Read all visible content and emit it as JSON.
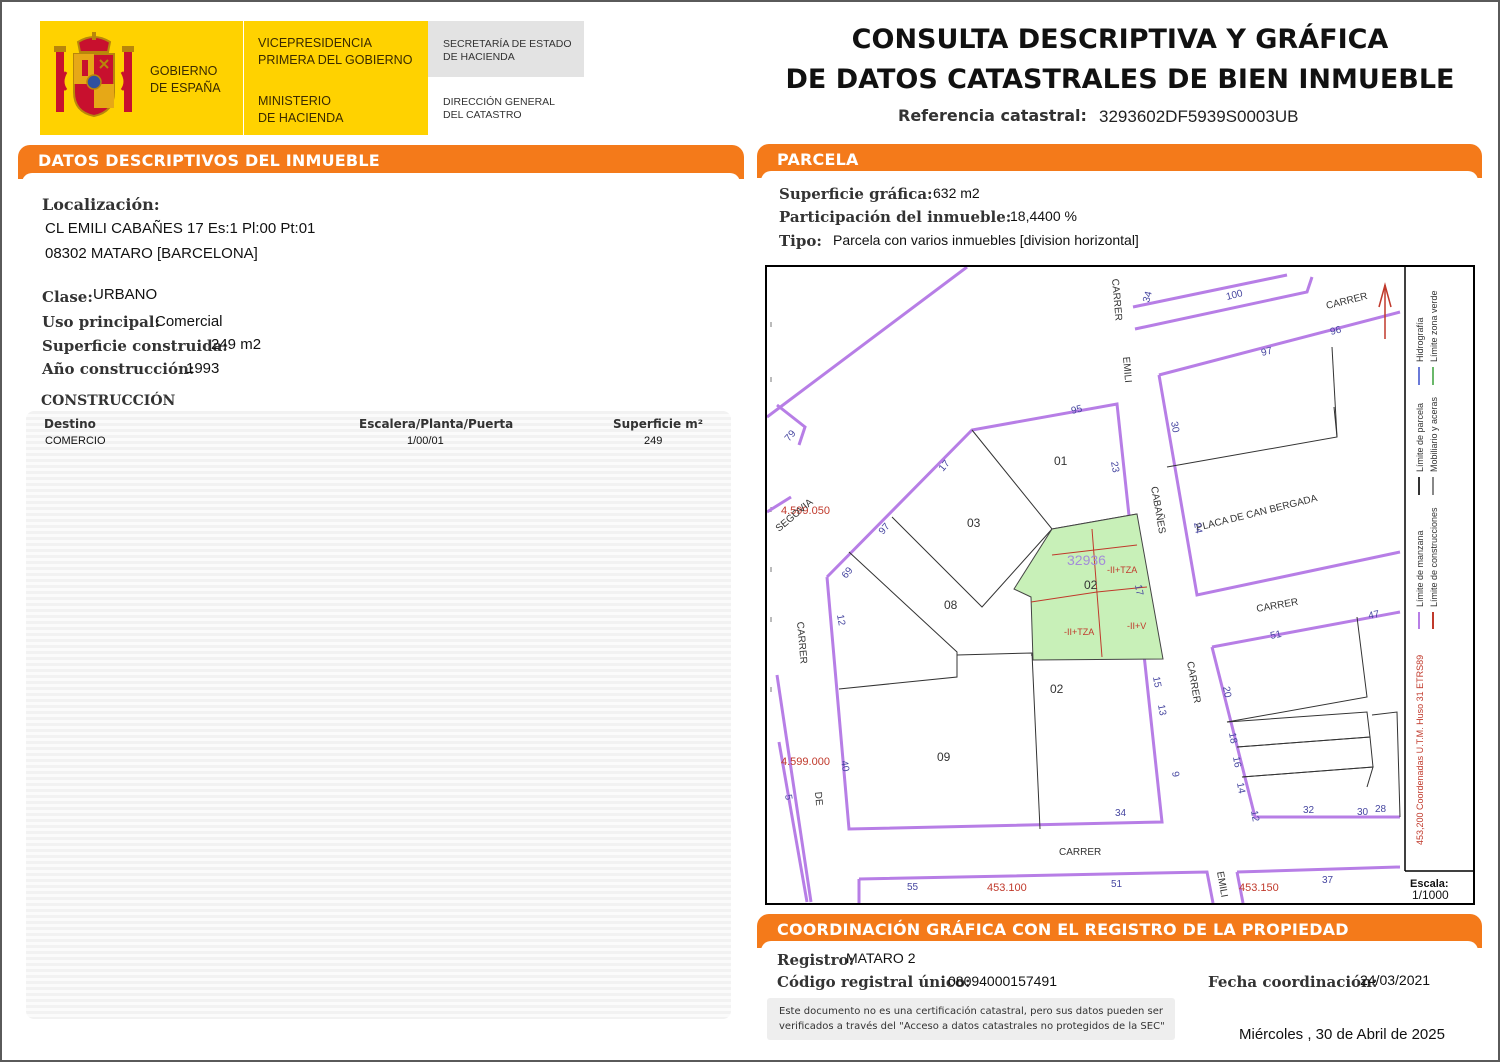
{
  "header": {
    "gov_line1": "Gobierno",
    "gov_line2": "de España",
    "vice_line1": "Vicepresidencia",
    "vice_line2": "Primera del Gobierno",
    "min_line1": "Ministerio",
    "min_line2": "de Hacienda",
    "sec_line1": "Secretaría de Estado",
    "sec_line2": "de Hacienda",
    "dir_line1": "Dirección General",
    "dir_line2": "del Catastro",
    "title_line1": "CONSULTA DESCRIPTIVA Y GRÁFICA",
    "title_line2": "DE DATOS CATASTRALES DE BIEN INMUEBLE",
    "ref_label": "Referencia catastral:",
    "ref_value": "3293602DF5939S0003UB"
  },
  "descriptivos": {
    "section_title": "DATOS DESCRIPTIVOS DEL INMUEBLE",
    "loc_label": "Localización:",
    "loc_line1": "CL EMILI CABAÑES 17 Es:1 Pl:00 Pt:01",
    "loc_line2": "08302 MATARO [BARCELONA]",
    "clase_label": "Clase:",
    "clase_value": "URBANO",
    "uso_label": "Uso principal:",
    "uso_value": "Comercial",
    "sup_label": "Superficie construida:",
    "sup_value": "249 m2",
    "anio_label": "Año construcción:",
    "anio_value": "1993"
  },
  "construccion": {
    "title": "CONSTRUCCIÓN",
    "col_destino": "Destino",
    "col_epp": "Escalera/Planta/Puerta",
    "col_sup": "Superficie m²",
    "rows": [
      {
        "destino": "COMERCIO",
        "epp": "1/00/01",
        "sup": "249"
      }
    ]
  },
  "parcela": {
    "section_title": "PARCELA",
    "sup_label": "Superficie gráfica:",
    "sup_value": "632 m2",
    "part_label": "Participación del inmueble:",
    "part_value": "18,4400 %",
    "tipo_label": "Tipo:",
    "tipo_value": "Parcela con varios inmuebles [division horizontal]"
  },
  "map": {
    "parcel_id": "32936",
    "parcel_tag1": "-II+TZA",
    "parcel_tag2": "-II+TZA",
    "parcel_tag3": "-II+V",
    "parcel_number": "02",
    "parcel_num_17": "17",
    "lot_01": "01",
    "lot_03": "03",
    "lot_08": "08",
    "lot_02b": "02",
    "lot_09": "09",
    "plaza": "PLACA DE CAN BERGADA",
    "street_carrer_top": "CARRER",
    "street_carrer_mid": "CARRER",
    "street_carrer_bottom": "CARRER",
    "street_carrer_left": "CARRER",
    "street_carrer_right": "CARRER",
    "street_emili": "EMILI",
    "street_cabanes": "CABAÑES",
    "street_segovia": "SEGOVIA",
    "street_de": "DE",
    "street_emili_bottom": "EMILI",
    "coord_y1": "4.599.050",
    "coord_y2": "4.599.000",
    "coord_x1": "453.100",
    "coord_x2": "453.150",
    "n_34": "34",
    "n_100": "100",
    "n_96": "96",
    "n_97": "97",
    "n_95": "95",
    "n_23": "23",
    "n_30": "30",
    "n_24": "24",
    "n_79": "79",
    "n_17a": "17",
    "n_97b": "97",
    "n_69": "69",
    "n_12": "12",
    "n_51": "51",
    "n_47": "47",
    "n_15": "15",
    "n_13": "13",
    "n_20": "20",
    "n_18": "18",
    "n_16": "16",
    "n_14": "14",
    "n_12b": "12",
    "n_32": "32",
    "n_30b": "30",
    "n_28": "28",
    "n_9": "9",
    "n_34b": "34",
    "n_40": "40",
    "n_5": "5",
    "n_55": "55",
    "n_51b": "51",
    "n_37": "37",
    "legend_manzana": "Límite de manzana",
    "legend_parcela": "Límite de parcela",
    "legend_hidro": "Hidrografía",
    "legend_construcciones": "Límite de construcciones",
    "legend_mobiliario": "Mobiliario y aceras",
    "legend_verde": "Límite zona verde",
    "utm": "453,200 Coordenadas U.T.M. Huso 31 ETRS89",
    "escala_label": "Escala:",
    "escala_value": "1/1000"
  },
  "coordinacion": {
    "section_title": "COORDINACIÓN GRÁFICA CON EL REGISTRO DE LA PROPIEDAD",
    "registro_label": "Registro:",
    "registro_value": "MATARO 2",
    "codigo_label": "Código registral único:",
    "codigo_value": "08094000157491",
    "fecha_label": "Fecha coordinación:",
    "fecha_value": "24/03/2021",
    "notice_line1": "Este documento no es una certificación catastral, pero sus datos pueden ser",
    "notice_line2": "verificados a través del \"Acceso a datos catastrales no protegidos de la SEC\"",
    "date": "Miércoles , 30 de Abril de 2025"
  },
  "colors": {
    "orange": "#f47a1a",
    "yellow": "#ffd200",
    "parcel_fill": "#c8f0b8",
    "block_line": "#b77ee6",
    "coord_red": "#c0392b"
  }
}
